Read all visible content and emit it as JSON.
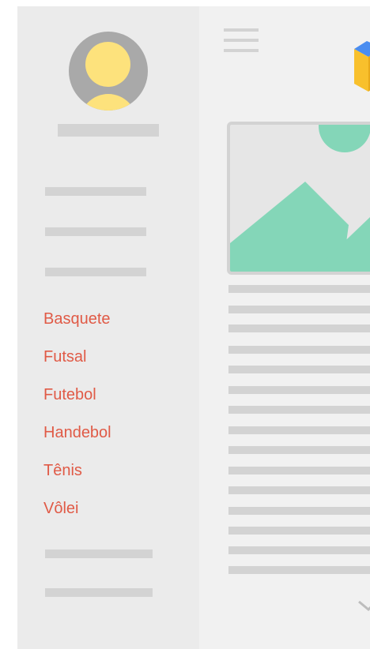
{
  "drawer": {
    "sports": [
      "Basquete",
      "Futsal",
      "Futebol",
      "Handebol",
      "Tênis",
      "Vôlei"
    ]
  },
  "colors": {
    "accent": "#e05a46",
    "placeholder": "#d3d3d3",
    "drawer_bg": "#ebebeb",
    "content_bg": "#f1f1f1",
    "avatar_bg": "#a9a9a9",
    "avatar_fg": "#fde27c",
    "image_shapes": "#84d6b8"
  },
  "icons": {
    "menu": "hamburger-menu-icon",
    "logo": "cube-logo-icon",
    "image": "image-placeholder-icon",
    "chevron": "chevron-down-icon"
  }
}
